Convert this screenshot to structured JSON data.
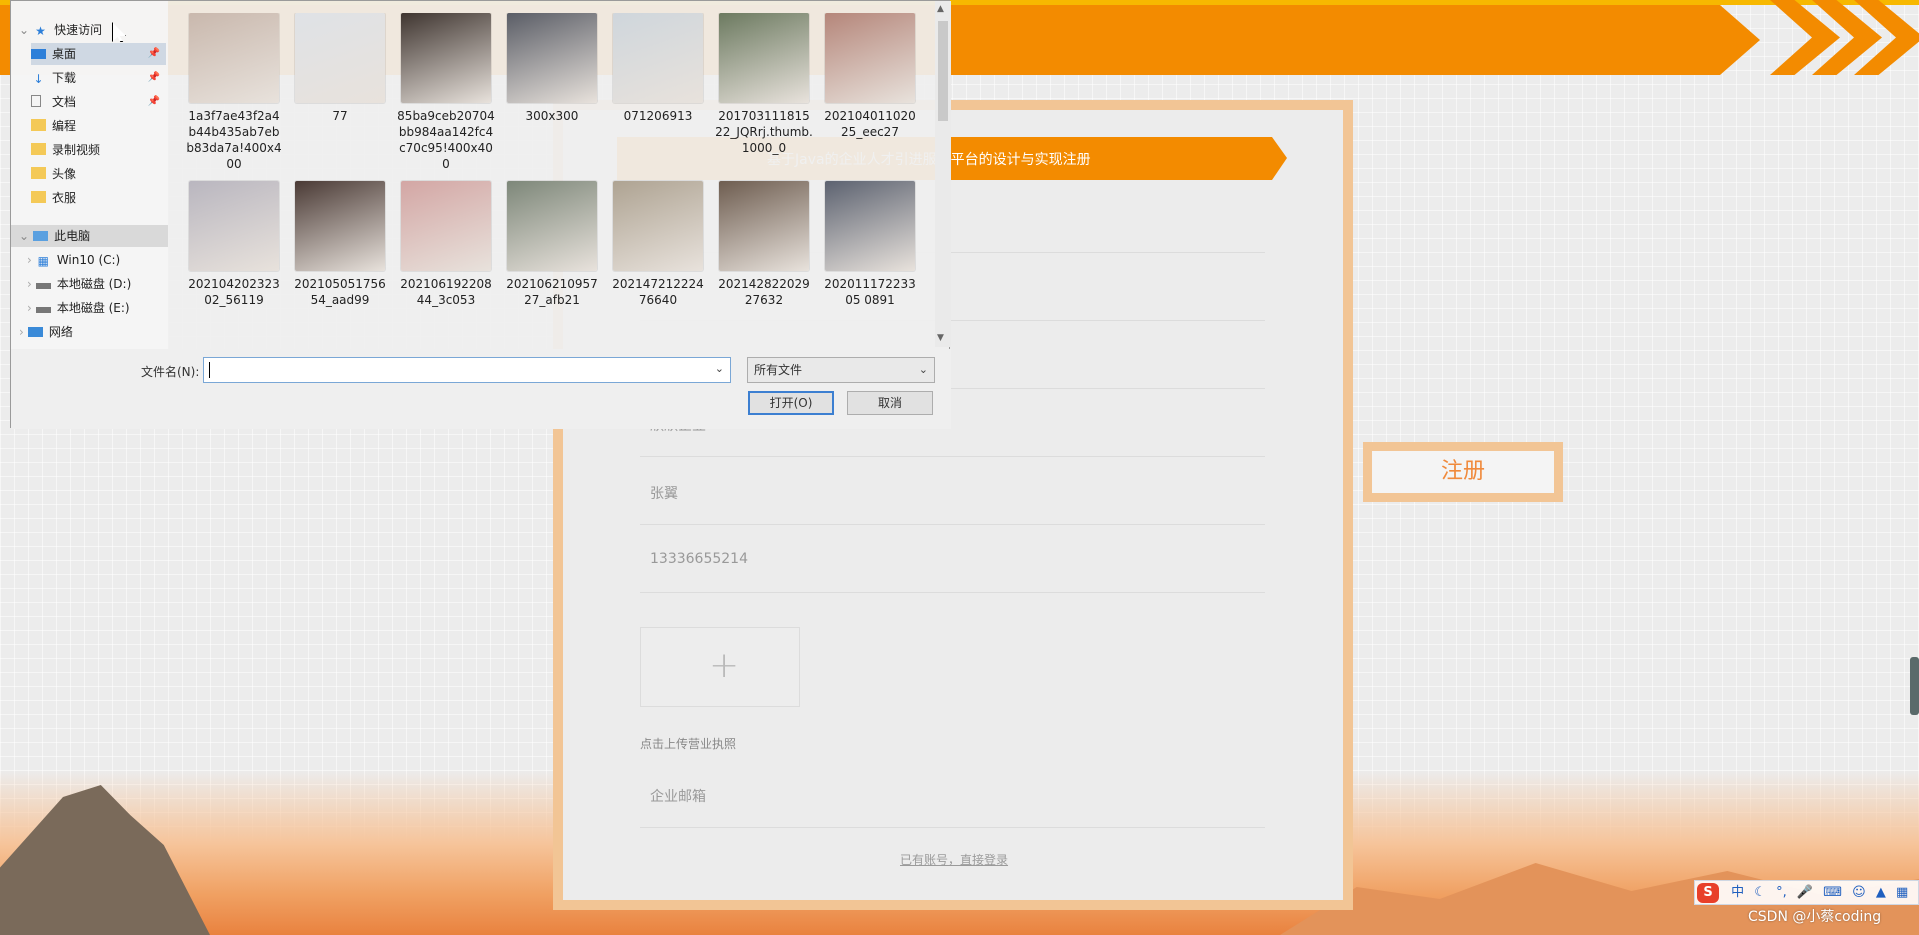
{
  "banner": {
    "accent": "#f38b00"
  },
  "register_form": {
    "title": "基于Java的企业人才引进服务平台的设计与实现注册",
    "company_name": "欣欣企业",
    "contact_person": "张翼",
    "phone": "13336655214",
    "upload_icon": "plus-icon",
    "upload_hint": "点击上传营业执照",
    "email_placeholder": "企业邮箱",
    "login_link": "已有账号，直接登录",
    "register_button": "注册"
  },
  "file_dialog": {
    "nav": {
      "quick_access": "快速访问",
      "desktop": "桌面",
      "downloads": "下载",
      "documents": "文档",
      "folder_programming": "编程",
      "folder_recording": "录制视频",
      "folder_avatar": "头像",
      "folder_clothes": "衣服",
      "this_pc": "此电脑",
      "drive_c": "Win10 (C:)",
      "drive_d": "本地磁盘 (D:)",
      "drive_e": "本地磁盘 (E:)",
      "network": "网络"
    },
    "files": [
      {
        "name": "1a3f7ae43f2a4b44b435ab7ebb83da7a!400x400",
        "color": "#c9b8ad"
      },
      {
        "name": "77",
        "color": "#dfe2e6"
      },
      {
        "name": "85ba9ceb20704bb984aa142fc4c70c95!400x400",
        "color": "#3f3530"
      },
      {
        "name": "300x300",
        "color": "#5a5d66"
      },
      {
        "name": "071206913",
        "color": "#cfd6dc"
      },
      {
        "name": "20170311181522_JQRrj.thumb.1000_0",
        "color": "#6c7a60"
      },
      {
        "name": "20210401102025_eec27",
        "color": "#b5867a"
      },
      {
        "name": "20210420232302_56119",
        "color": "#b9b6bf"
      },
      {
        "name": "20210505175654_aad99",
        "color": "#4a3a35"
      },
      {
        "name": "20210619220844_3c053",
        "color": "#d3a6a4"
      },
      {
        "name": "20210621095727_afb21",
        "color": "#7d8779"
      },
      {
        "name": "20214721222476640",
        "color": "#aea392"
      },
      {
        "name": "20214282202927632",
        "color": "#6e5d50"
      },
      {
        "name": "20201117223305 0891",
        "color": "#5c6270"
      },
      {
        "name": "",
        "color": "#4f4540"
      },
      {
        "name": "",
        "color": "#615650"
      },
      {
        "name": "",
        "color": "#8d8a9a"
      },
      {
        "name": "",
        "color": "#3a3a3a"
      },
      {
        "name": "",
        "color": "#9aa0a8"
      },
      {
        "name": "",
        "color": "#a89890"
      },
      {
        "name": "",
        "color": "#7b6d68"
      }
    ],
    "filename_label": "文件名(N):",
    "filename_value": "",
    "filetype": "所有文件",
    "open_button": "打开(O)",
    "cancel_button": "取消"
  },
  "ime": {
    "cn": "中"
  },
  "watermark": "CSDN @小蔡coding"
}
